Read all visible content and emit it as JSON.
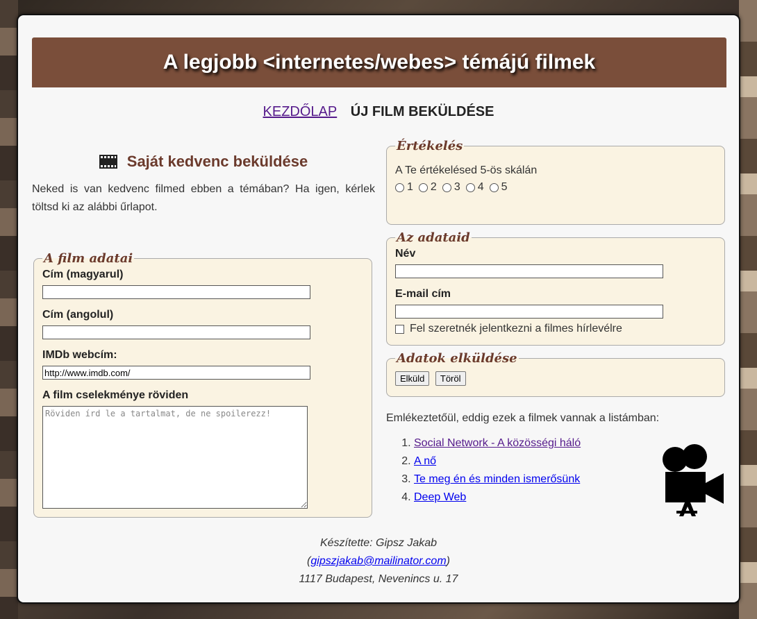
{
  "header": {
    "title": "A legjobb <internetes/webes> témájú filmek"
  },
  "nav": {
    "home": "KEZDŐLAP",
    "current": "ÚJ FILM BEKÜLDÉSE"
  },
  "left": {
    "heading": "Saját kedvenc beküldése",
    "intro": "Neked is van kedvenc filmed ebben a témában? Ha igen, kérlek töltsd ki az alábbi űrlapot."
  },
  "film_form": {
    "legend": "A film adatai",
    "title_hu_label": "Cím (magyarul)",
    "title_hu_value": "",
    "title_en_label": "Cím (angolul)",
    "title_en_value": "",
    "imdb_label": "IMDb webcím:",
    "imdb_value": "http://www.imdb.com/",
    "plot_label": "A film cselekménye röviden",
    "plot_placeholder": "Röviden írd le a tartalmat, de ne spoilerezz!"
  },
  "rating": {
    "legend": "Értékelés",
    "text": "A Te értékelésed 5-ös skálán",
    "options": [
      "1",
      "2",
      "3",
      "4",
      "5"
    ]
  },
  "user": {
    "legend": "Az adataid",
    "name_label": "Név",
    "email_label": "E-mail cím",
    "newsletter_label": "Fel szeretnék jelentkezni a filmes hírlevélre"
  },
  "send": {
    "legend": "Adatok elküldése",
    "submit": "Elküld",
    "reset": "Töröl"
  },
  "list": {
    "intro": "Emlékeztetőül, eddig ezek a filmek vannak a listámban:",
    "items": [
      "Social Network - A közösségi háló",
      "A nő",
      "Te meg én és minden ismerősünk",
      "Deep Web"
    ]
  },
  "footer": {
    "author": "Készítette: Gipsz Jakab",
    "email": "gipszjakab@mailinator.com",
    "address": "1117 Budapest, Nevenincs u. 17"
  },
  "icons": {
    "film": "film-strip-icon",
    "camera": "movie-camera-icon"
  },
  "colors": {
    "banner": "#7a4e3a",
    "heading": "#6b3a2c",
    "fieldset_bg": "#faf3e2"
  }
}
